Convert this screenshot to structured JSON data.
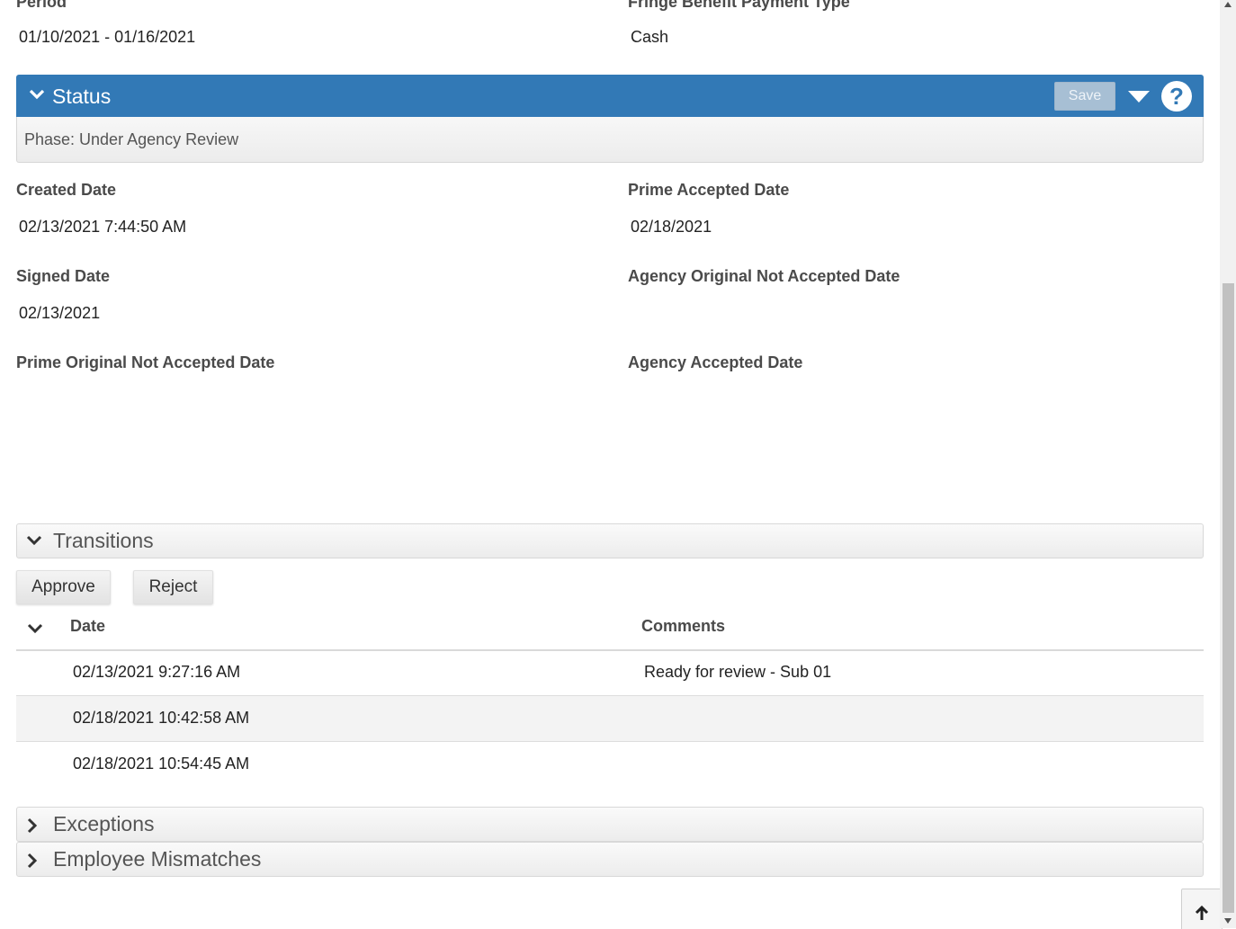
{
  "top_fields": {
    "period_label": "Period",
    "period_value": "01/10/2021 - 01/16/2021",
    "fringe_label": "Fringe Benefit Payment Type",
    "fringe_value": "Cash"
  },
  "status": {
    "title": "Status",
    "save_label": "Save",
    "help_glyph": "?",
    "phase_text": "Phase: Under Agency Review",
    "header_color": "#3279b6"
  },
  "fields": {
    "created_date_label": "Created Date",
    "created_date_value": "02/13/2021 7:44:50 AM",
    "prime_accepted_label": "Prime Accepted Date",
    "prime_accepted_value": "02/18/2021",
    "signed_date_label": "Signed Date",
    "signed_date_value": "02/13/2021",
    "agency_orig_not_accepted_label": "Agency Original Not Accepted Date",
    "prime_orig_not_accepted_label": "Prime Original Not Accepted Date",
    "agency_accepted_label": "Agency Accepted Date"
  },
  "transitions": {
    "title": "Transitions",
    "approve_label": "Approve",
    "reject_label": "Reject",
    "columns": {
      "date": "Date",
      "comments": "Comments"
    },
    "rows": [
      {
        "date": "02/13/2021 9:27:16 AM",
        "comment": "Ready for review - Sub 01"
      },
      {
        "date": "02/18/2021 10:42:58 AM",
        "comment": ""
      },
      {
        "date": "02/18/2021 10:54:45 AM",
        "comment": ""
      }
    ]
  },
  "panels": {
    "exceptions": "Exceptions",
    "employee_mismatches": "Employee Mismatches"
  },
  "icons": {
    "collapse": "chevron-down-icon",
    "expand": "chevron-right-icon",
    "menu": "caret-down-icon",
    "help": "help-icon",
    "scroll_top": "arrow-up-icon"
  }
}
